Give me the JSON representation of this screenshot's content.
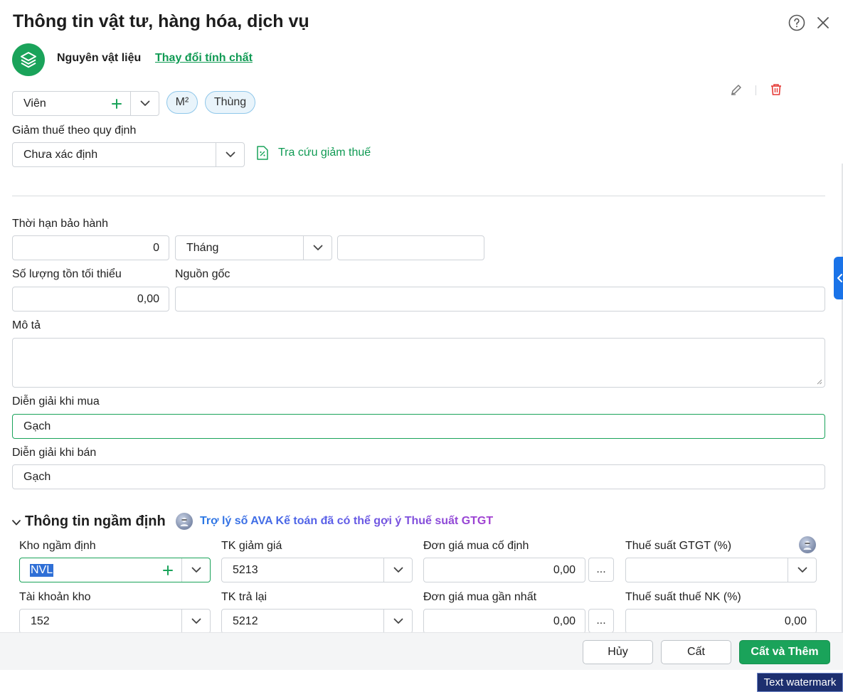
{
  "header": {
    "title": "Thông tin vật tư, hàng hóa, dịch vụ"
  },
  "nature": {
    "label": "Nguyên vật liệu",
    "change_link": "Thay đổi tính chất"
  },
  "unit": {
    "value": "Viên",
    "chips": [
      "M²",
      "Thùng"
    ]
  },
  "tax_reduction": {
    "label": "Giảm thuế theo quy định",
    "value": "Chưa xác định",
    "lookup_link": "Tra cứu giảm thuế"
  },
  "warranty": {
    "label": "Thời hạn bảo hành",
    "amount": "0",
    "period": "Tháng",
    "note": ""
  },
  "min_stock": {
    "label": "Số lượng tồn tối thiểu",
    "value": "0,00"
  },
  "origin": {
    "label": "Nguồn gốc",
    "value": ""
  },
  "description": {
    "label": "Mô tả",
    "value": ""
  },
  "purchase_desc": {
    "label": "Diễn giải khi mua",
    "value": "Gạch"
  },
  "sale_desc": {
    "label": "Diễn giải khi bán",
    "value": "Gạch"
  },
  "defaults": {
    "section_title": "Thông tin ngầm định",
    "ava_hint": "Trợ lý số AVA Kế toán đã có thể gợi ý Thuế suất GTGT",
    "warehouse": {
      "label": "Kho ngầm định",
      "value": "NVL"
    },
    "discount_account": {
      "label": "TK giảm giá",
      "value": "5213"
    },
    "fixed_purchase_price": {
      "label": "Đơn giá mua cố định",
      "value": "0,00",
      "more": "..."
    },
    "vat_rate": {
      "label": "Thuế suất GTGT (%)",
      "value": ""
    },
    "stock_account": {
      "label": "Tài khoản kho",
      "value": "152"
    },
    "return_account": {
      "label": "TK trả lại",
      "value": "5212"
    },
    "latest_purchase_price": {
      "label": "Đơn giá mua gần nhất",
      "value": "0,00",
      "more": "..."
    },
    "import_tax_rate": {
      "label": "Thuế suất thuế NK (%)",
      "value": "0,00"
    }
  },
  "footer": {
    "cancel": "Hủy",
    "save": "Cất",
    "save_add": "Cất và Thêm"
  },
  "watermark": "Text watermark",
  "colors": {
    "accent": "#1aa35a",
    "link": "#0f9a53",
    "delete": "#e53935",
    "side_tab": "#1a73e8"
  },
  "icons": [
    "help-icon",
    "close-icon",
    "layers-icon",
    "plus-icon",
    "chevron-down-icon",
    "edit-icon",
    "delete-icon",
    "document-tax-icon",
    "ava-avatar-icon"
  ]
}
